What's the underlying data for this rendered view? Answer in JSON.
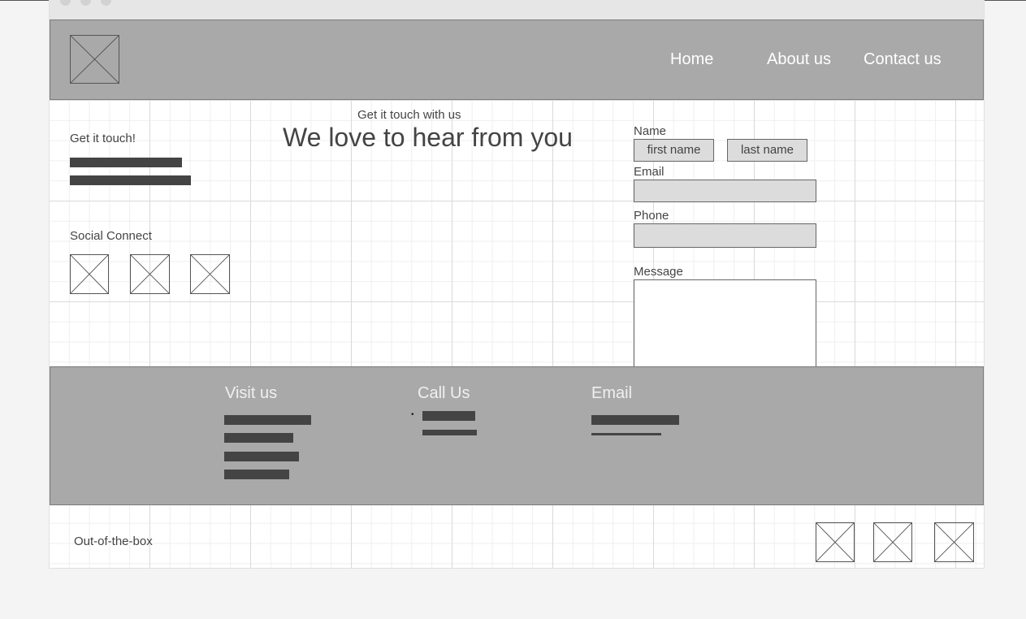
{
  "nav": {
    "home": "Home",
    "about": "About us",
    "contact": "Contact us"
  },
  "left": {
    "get_touch": "Get it touch!",
    "social": "Social Connect"
  },
  "hero": {
    "kicker": "Get it touch with us",
    "title": "We love to hear from you"
  },
  "form": {
    "name_label": "Name",
    "first_name": "first name",
    "last_name": "last name",
    "email_label": "Email",
    "phone_label": "Phone",
    "message_label": "Message"
  },
  "footer": {
    "visit": "Visit us",
    "call": "Call Us",
    "email": "Email",
    "bullet": "•"
  },
  "bottom": {
    "brand": "Out-of-the-box"
  },
  "icons": {
    "placeholder": "image-placeholder-icon"
  },
  "colors": {
    "header_bg": "#a9a9a9",
    "footer_bg": "#a9a9a9",
    "text_dark": "#444444",
    "field_bg": "#dcdcdc"
  }
}
